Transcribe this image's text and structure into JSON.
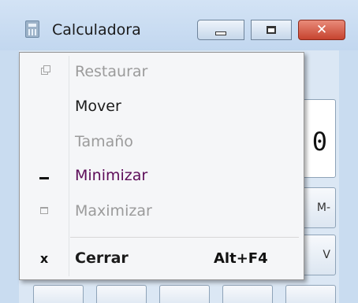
{
  "window": {
    "title": "Calculadora",
    "close_glyph": "✕",
    "icons": {
      "app": "calculator-icon",
      "minimize": "minimize-icon",
      "maximize": "maximize-icon",
      "close": "close-icon"
    }
  },
  "calculator": {
    "display_value": "0",
    "memory_key_label": "M-",
    "back_key_label": "V"
  },
  "menu": {
    "items": [
      {
        "label": "Restaurar",
        "enabled": false,
        "icon": "restore-icon"
      },
      {
        "label": "Mover",
        "enabled": true,
        "icon": ""
      },
      {
        "label": "Tamaño",
        "enabled": false,
        "icon": ""
      },
      {
        "label": "Minimizar",
        "enabled": true,
        "icon": "minimize-bar-icon"
      },
      {
        "label": "Maximizar",
        "enabled": false,
        "icon": "maximize-box-icon"
      },
      {
        "label": "Cerrar",
        "enabled": true,
        "icon": "close-x-icon",
        "shortcut": "Alt+F4",
        "bold": true
      }
    ],
    "close_glyph": "x"
  },
  "colors": {
    "title_bg": "#c9dcf0",
    "menu_bg": "#f5f6f8",
    "disabled_text": "#9b9b9b",
    "close_button": "#c6432f"
  }
}
